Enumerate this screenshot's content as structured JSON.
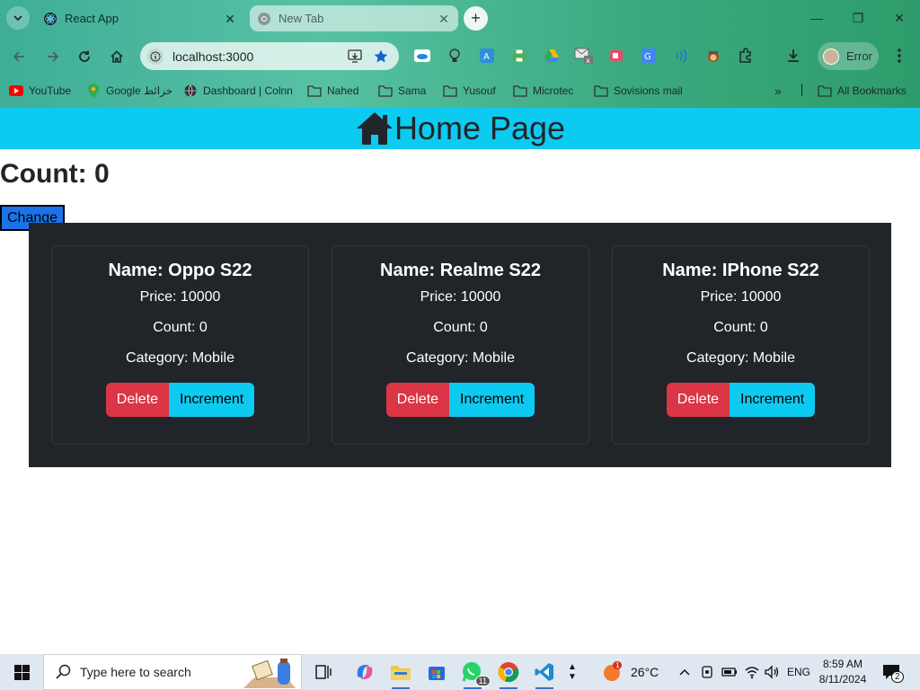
{
  "browser": {
    "tabs": [
      {
        "title": "React App",
        "active": true
      },
      {
        "title": "New Tab",
        "active": false
      }
    ],
    "url": "localhost:3000",
    "profile_label": "Error",
    "bookmarks": [
      {
        "label": "YouTube",
        "icon": "youtube-icon"
      },
      {
        "label": "Google خرائط",
        "icon": "google-maps-icon"
      },
      {
        "label": "Dashboard | Colnn",
        "icon": "globe-icon"
      },
      {
        "label": "Nahed",
        "icon": "folder-icon"
      },
      {
        "label": "Sama",
        "icon": "folder-icon"
      },
      {
        "label": "Yusouf",
        "icon": "folder-icon"
      },
      {
        "label": "Microtec",
        "icon": "folder-icon"
      },
      {
        "label": "Sovisions mail",
        "icon": "folder-icon"
      }
    ],
    "all_bookmarks": "All Bookmarks"
  },
  "page": {
    "header_title": "Home Page",
    "count_label": "Count: 0",
    "change_button": "Change",
    "products": [
      {
        "name": "Name: Oppo S22",
        "price": "Price: 10000",
        "count": "Count: 0",
        "category": "Category: Mobile",
        "delete": "Delete",
        "increment": "Increment"
      },
      {
        "name": "Name: Realme S22",
        "price": "Price: 10000",
        "count": "Count: 0",
        "category": "Category: Mobile",
        "delete": "Delete",
        "increment": "Increment"
      },
      {
        "name": "Name: IPhone S22",
        "price": "Price: 10000",
        "count": "Count: 0",
        "category": "Category: Mobile",
        "delete": "Delete",
        "increment": "Increment"
      }
    ]
  },
  "taskbar": {
    "search_placeholder": "Type here to search",
    "weather": "26°C",
    "weather_badge": "1",
    "whatsapp_badge": "11",
    "language": "ENG",
    "time": "8:59 AM",
    "date": "8/11/2024",
    "notifications": "2"
  },
  "colors": {
    "header": "#0dcaf0",
    "products_bg": "#212529",
    "delete": "#dc3545",
    "increment": "#0dcaf0",
    "change_button": "#1a73e8"
  }
}
